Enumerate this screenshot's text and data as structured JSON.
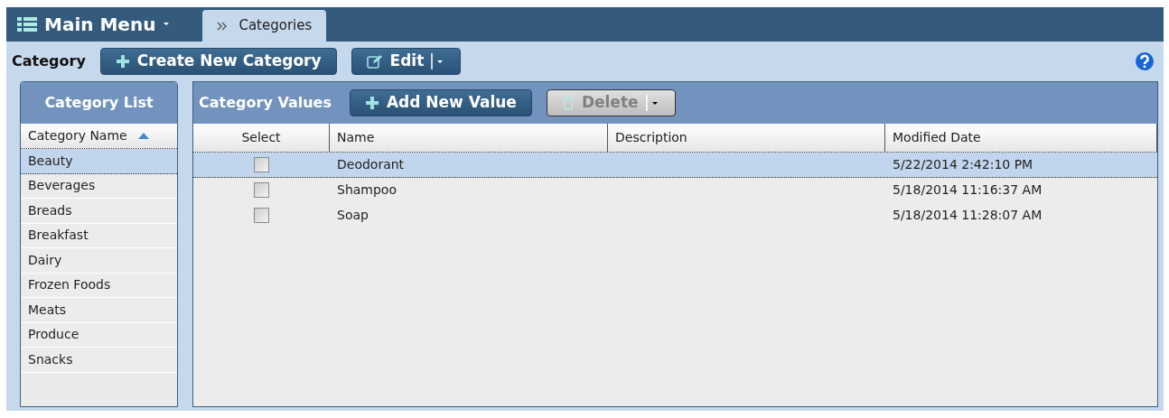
{
  "header": {
    "menu_label": "Main Menu",
    "tabs": [
      {
        "label": "Categories",
        "selected": true
      }
    ]
  },
  "toolbar": {
    "label": "Category",
    "buttons": [
      {
        "kind": "create",
        "label": "Create New Category",
        "disabled": false
      },
      {
        "kind": "edit",
        "label": "Edit",
        "disabled": false
      }
    ]
  },
  "category_list": {
    "title": "Category List",
    "column": "Category Name",
    "sort_ascending": true,
    "rows": [
      {
        "name": "Beauty",
        "selected": true
      },
      {
        "name": "Beverages",
        "selected": false
      },
      {
        "name": "Breads",
        "selected": false
      },
      {
        "name": "Breakfast",
        "selected": false
      },
      {
        "name": "Dairy",
        "selected": false
      },
      {
        "name": "Frozen Foods",
        "selected": false
      },
      {
        "name": "Meats",
        "selected": false
      },
      {
        "name": "Produce",
        "selected": false
      },
      {
        "name": "Snacks",
        "selected": false
      }
    ]
  },
  "category_values": {
    "title": "Category Values",
    "buttons": [
      {
        "kind": "add",
        "label": "Add New Value",
        "disabled": false
      },
      {
        "kind": "delete",
        "label": "Delete",
        "disabled": true
      }
    ],
    "columns": [
      "Select",
      "Name",
      "Description",
      "Modified Date"
    ],
    "rows": [
      {
        "checked": false,
        "name": "Deodorant",
        "modified": "5/22/2014 2:42:10 PM",
        "selected": true
      },
      {
        "checked": false,
        "name": "Shampoo",
        "modified": "5/18/2014 11:16:37 AM",
        "selected": false
      },
      {
        "checked": false,
        "name": "Soap",
        "modified": "5/18/2014 11:28:07 AM",
        "selected": false
      }
    ]
  }
}
